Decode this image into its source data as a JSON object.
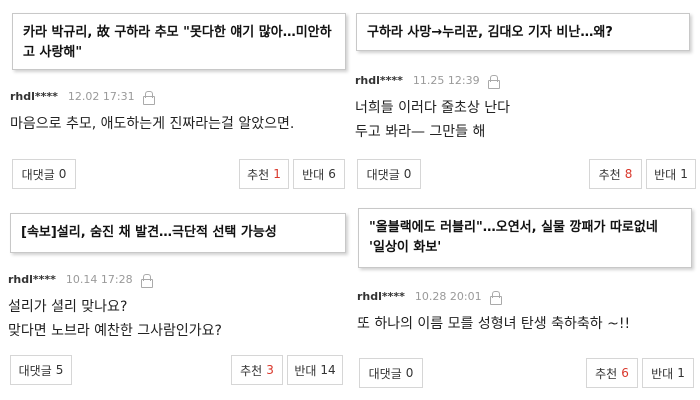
{
  "comments": [
    {
      "title": "카라 박규리, 故 구하라 추모 \"못다한 얘기 많아…미안하고 사랑해\"",
      "title_line1": "카라 박규리, 故 구하라 추모 \"못다한 얘기 많아…미안하",
      "title_line2": "고 사랑해\"",
      "user": "rhdl****",
      "time": "12.02 17:31",
      "lines": [
        "마음으로 추모, 애도하는게 진짜라는걸 알았으면."
      ],
      "reply_label": "대댓글",
      "reply_count": "0",
      "like_label": "추천",
      "like_count": "1",
      "dislike_label": "반대",
      "dislike_count": "6"
    },
    {
      "title": "구하라 사망→누리꾼, 김대오 기자 비난…왜?",
      "user": "rhdl****",
      "time": "11.25 12:39",
      "lines": [
        "너희들 이러다 줄초상 난다",
        "두고 봐라— 그만들 해"
      ],
      "reply_label": "대댓글",
      "reply_count": "0",
      "like_label": "추천",
      "like_count": "8",
      "dislike_label": "반대",
      "dislike_count": "1"
    },
    {
      "title": "[속보]설리, 숨진 채 발견…극단적 선택 가능성",
      "user": "rhdl****",
      "time": "10.14 17:28",
      "lines": [
        "설리가 셜리 맞나요?",
        "맞다면 노브라 예찬한 그사람인가요?"
      ],
      "reply_label": "대댓글",
      "reply_count": "5",
      "like_label": "추천",
      "like_count": "3",
      "dislike_label": "반대",
      "dislike_count": "14"
    },
    {
      "title": "\"올블랙에도 러블리\"…오연서, 실물 깡패가 따로없네 '일상이 화보'",
      "title_line1": "\"올블랙에도 러블리\"…오연서, 실물 깡패가 따로없네",
      "title_line2": "'일상이 화보'",
      "user": "rhdl****",
      "time": "10.28 20:01",
      "lines": [
        "또 하나의 이름 모를 성형녀 탄생 축하축하 ~!!"
      ],
      "reply_label": "대댓글",
      "reply_count": "0",
      "like_label": "추천",
      "like_count": "6",
      "dislike_label": "반대",
      "dislike_count": "1"
    }
  ],
  "colors": {
    "like_count": "#d9372b",
    "border": "#c8c8c8",
    "meta": "#9a9a9a"
  },
  "icons": {
    "privacy": "lock-icon"
  }
}
